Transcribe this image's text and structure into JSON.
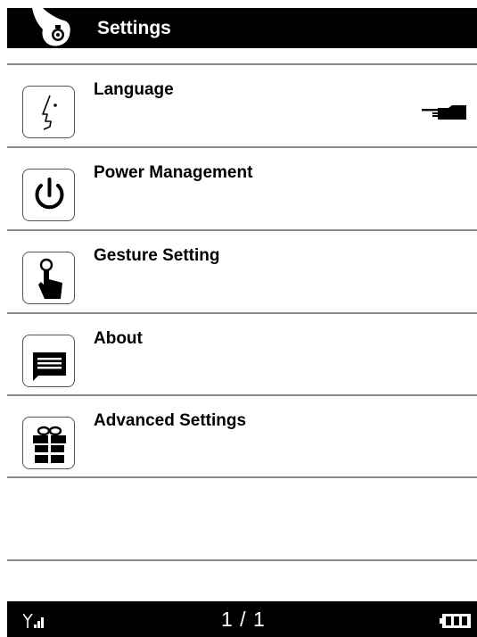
{
  "header": {
    "title": "Settings",
    "home_icon": "home-hand-icon"
  },
  "menu": [
    {
      "label": "Language",
      "icon": "face-profile-icon"
    },
    {
      "label": "Power Management",
      "icon": "power-icon"
    },
    {
      "label": "Gesture Setting",
      "icon": "touch-finger-icon"
    },
    {
      "label": "About",
      "icon": "message-icon"
    },
    {
      "label": "Advanced Settings",
      "icon": "gift-icon"
    }
  ],
  "selection": {
    "pointer_icon": "pointing-hand-icon",
    "pointed_item": "Language"
  },
  "footer": {
    "page": "1 / 1",
    "signal_icon": "signal-icon",
    "battery_icon": "battery-icon"
  }
}
